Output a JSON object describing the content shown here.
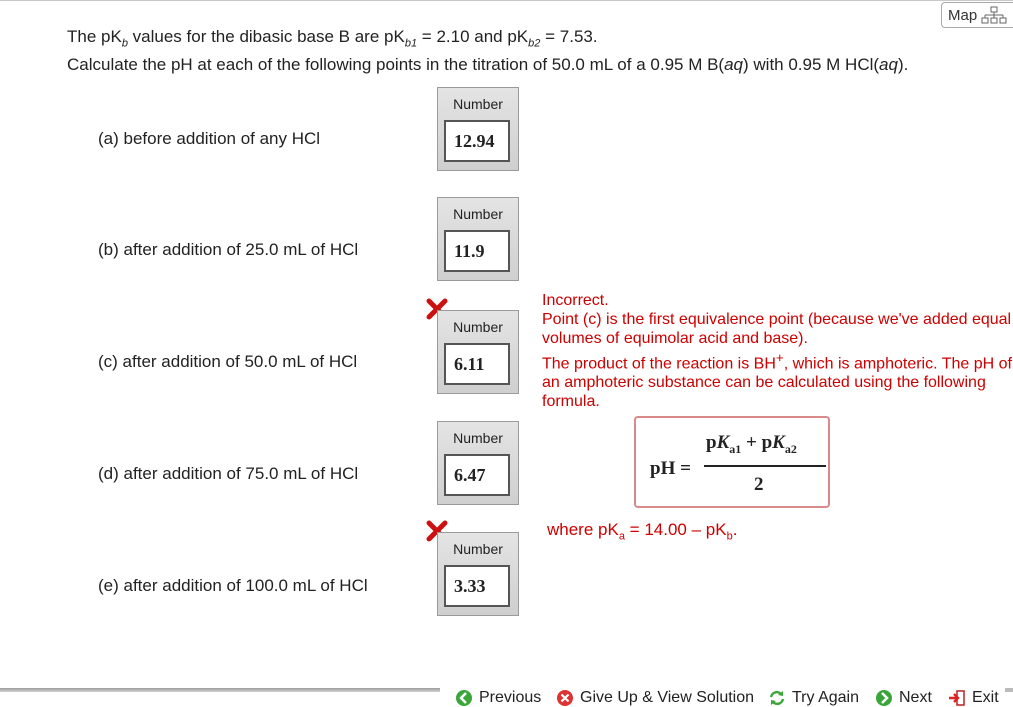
{
  "map": {
    "label": "Map",
    "icon": "sitemap-icon"
  },
  "header": {
    "line1": {
      "a": "The pK",
      "b_sub": "b",
      "c": " values for the dibasic base B are pK",
      "d_sub": "b1",
      "e": " = 2.10 and pK",
      "f_sub": "b2",
      "g": " = 7.53."
    },
    "line2": {
      "a": "Calculate the pH at each of the following points in the titration of 50.0 mL of a 0.95 M B(",
      "b_it": "aq",
      "c": ") with 0.95 M HCl(",
      "d_it": "aq",
      "e": ")."
    }
  },
  "questions": [
    {
      "label": "(a) before addition of any HCl",
      "caption": "Number",
      "value": "12.94",
      "incorrect": false
    },
    {
      "label": "(b) after addition of 25.0 mL of HCl",
      "caption": "Number",
      "value": "11.9",
      "incorrect": false
    },
    {
      "label": "(c) after addition of 50.0 mL of HCl",
      "caption": "Number",
      "value": "6.11",
      "incorrect": true
    },
    {
      "label": "(d) after addition of 75.0 mL of HCl",
      "caption": "Number",
      "value": "6.47",
      "incorrect": false
    },
    {
      "label": "(e) after addition of 100.0 mL of HCl",
      "caption": "Number",
      "value": "3.33",
      "incorrect": true
    }
  ],
  "feedback": {
    "title": "Incorrect.",
    "p1": "Point (c) is the first equivalence point (because we've added equal volumes of equimolar acid and base).",
    "p2a": "The product of the reaction is BH",
    "p2sup": "+",
    "p2b": ", which is amphoteric. The pH of an amphoteric substance can be calculated using the following formula."
  },
  "formula": {
    "lhs": "pH =",
    "p1": "p",
    "k1": "K",
    "s1": "a1",
    "plus": " + p",
    "k2": "K",
    "s2": "a2",
    "den": "2"
  },
  "where": {
    "a": "where pK",
    "a_sub": "a",
    "b": " = 14.00 – pK",
    "b_sub": "b",
    "c": "."
  },
  "nav": {
    "previous": "Previous",
    "giveup": "Give Up & View Solution",
    "tryagain": "Try Again",
    "next": "Next",
    "exit": "Exit"
  },
  "colors": {
    "incorrect": "#cc0000",
    "green": "#3aa63a"
  }
}
